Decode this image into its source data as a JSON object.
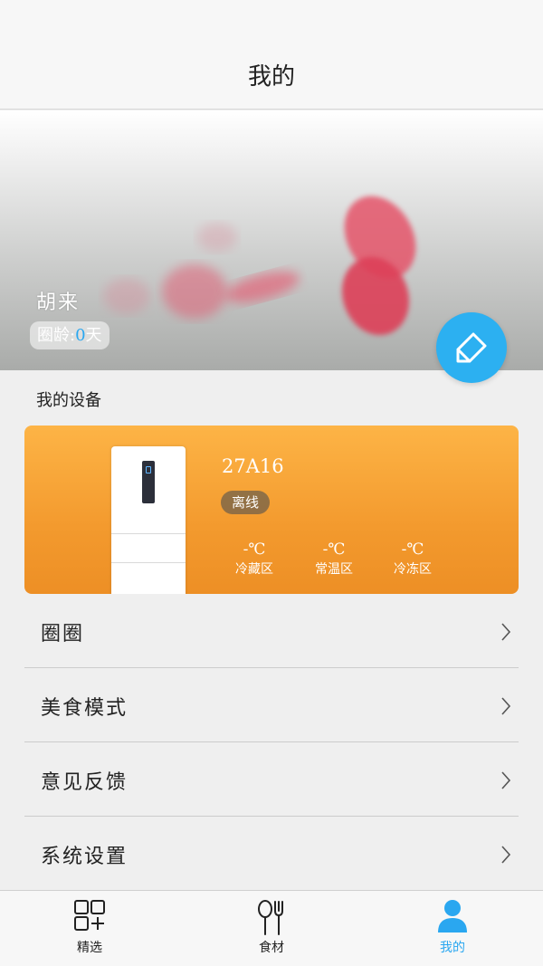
{
  "header": {
    "title": "我的"
  },
  "profile": {
    "name": "胡来",
    "age_label": "圈龄:",
    "age_days": "0",
    "age_unit": "天",
    "edit_icon": "edit-pencil-icon"
  },
  "devices": {
    "section_title": "我的设备",
    "card": {
      "name": "27A16",
      "status": "离线",
      "zones": [
        {
          "temp": "-℃",
          "label": "冷藏区"
        },
        {
          "temp": "-℃",
          "label": "常温区"
        },
        {
          "temp": "-℃",
          "label": "冷冻区"
        }
      ]
    }
  },
  "menu": {
    "items": [
      {
        "label": "圈圈"
      },
      {
        "label": "美食模式"
      },
      {
        "label": "意见反馈"
      },
      {
        "label": "系统设置"
      }
    ]
  },
  "tabs": [
    {
      "label": "精选",
      "icon": "grid-plus-icon"
    },
    {
      "label": "食材",
      "icon": "spoon-fork-icon"
    },
    {
      "label": "我的",
      "icon": "user-icon",
      "active": true
    }
  ],
  "colors": {
    "accent": "#2cb0f1",
    "card_top": "#fdb446",
    "card_bottom": "#ed8f25"
  }
}
